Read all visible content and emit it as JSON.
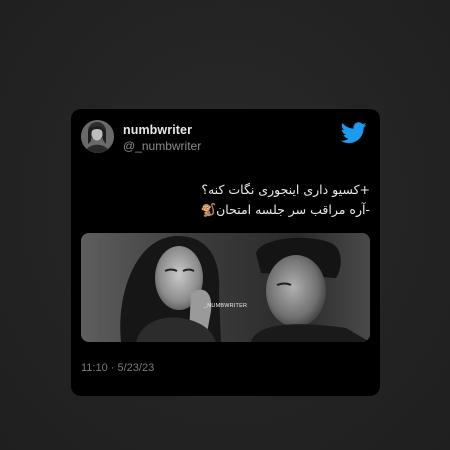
{
  "tweet": {
    "author": {
      "display_name": "numbwriter",
      "handle": "@_numbwriter",
      "avatar_icon": "profile-avatar"
    },
    "platform_icon": "twitter-bird-icon",
    "brand_color": "#1d9bf0",
    "text_lines": [
      "+کسیو داری اینجوری نگات کنه؟",
      "-آره مراقب سر جلسه امتحان🐒"
    ],
    "image": {
      "description_icon": "photo-woman-and-man",
      "watermark": "_NUMBWRITER"
    },
    "timestamp": "11:10 · 5/23/23"
  }
}
